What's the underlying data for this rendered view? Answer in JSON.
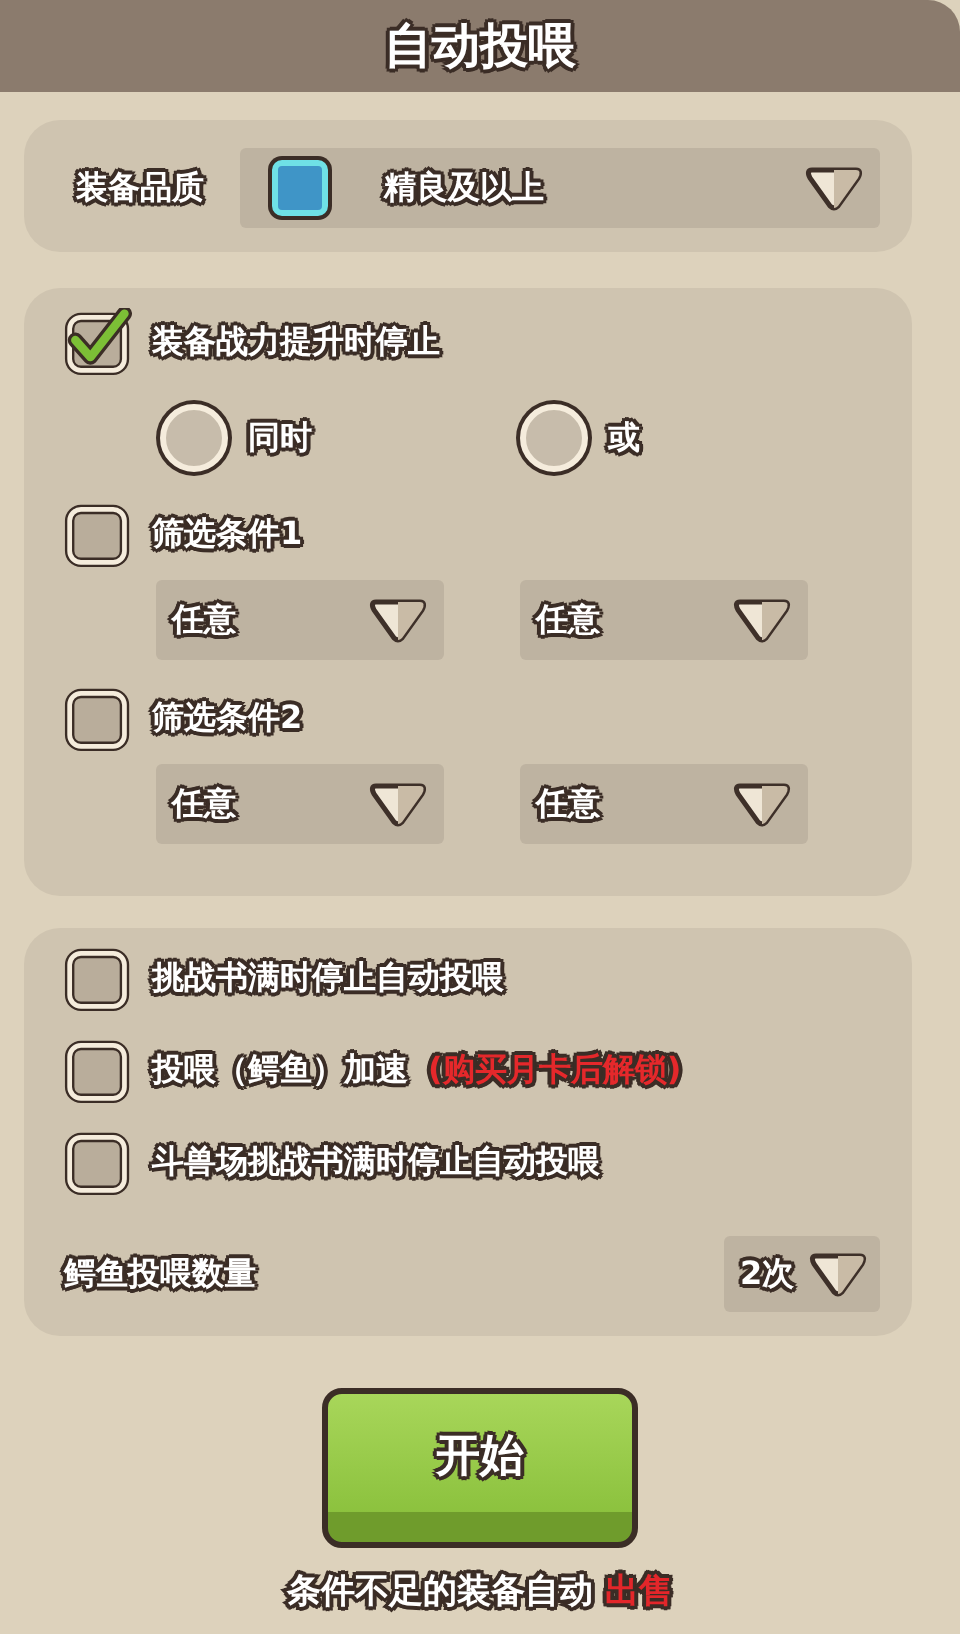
{
  "title": "自动投喂",
  "quality": {
    "label": "装备品质",
    "value": "精良及以上"
  },
  "stop_on_power": {
    "label": "装备战力提升时停止",
    "checked": true
  },
  "logic": [
    {
      "label": "同时",
      "selected": false
    },
    {
      "label": "或",
      "selected": false
    }
  ],
  "filters": [
    {
      "label": "筛选条件1",
      "checked": false,
      "options": [
        "任意",
        "任意"
      ]
    },
    {
      "label": "筛选条件2",
      "checked": false,
      "options": [
        "任意",
        "任意"
      ]
    }
  ],
  "options": [
    {
      "label": "挑战书满时停止自动投喂",
      "checked": false
    },
    {
      "label": "投喂（鳄鱼）加速",
      "note": "(购买月卡后解锁)",
      "checked": false
    },
    {
      "label": "斗兽场挑战书满时停止自动投喂",
      "checked": false
    }
  ],
  "feed_count": {
    "label": "鳄鱼投喂数量",
    "value": "2次"
  },
  "start_button": "开始",
  "footer": {
    "text": "条件不足的装备自动",
    "highlight": "出售"
  }
}
